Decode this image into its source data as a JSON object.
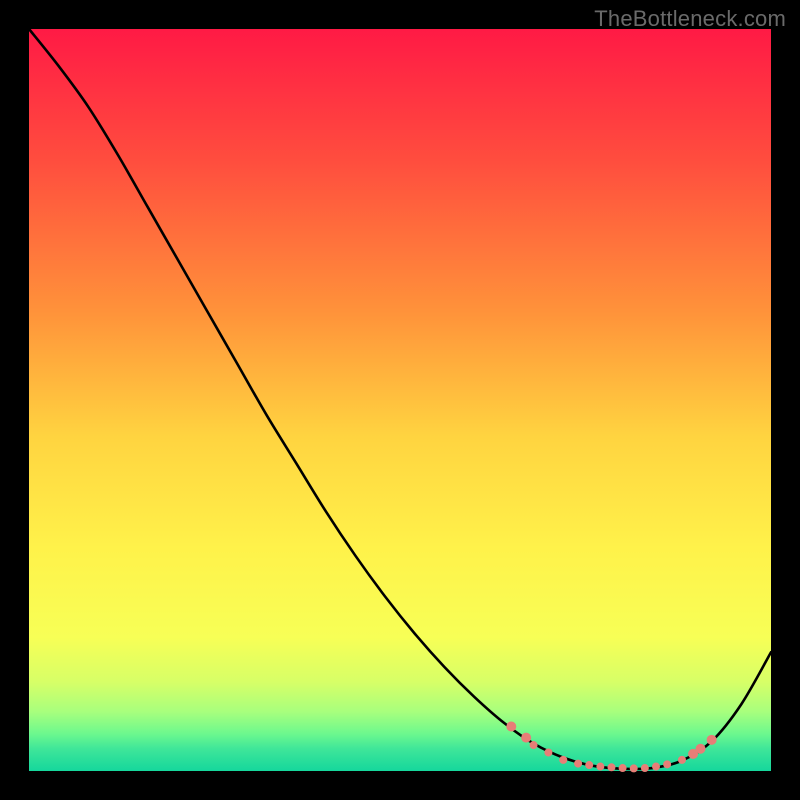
{
  "watermark": {
    "text": "TheBottleneck.com"
  },
  "chart_data": {
    "type": "line",
    "title": "",
    "xlabel": "",
    "ylabel": "",
    "xlim": [
      0,
      100
    ],
    "ylim": [
      0,
      100
    ],
    "gradient_stops": [
      {
        "offset": 0,
        "color": "#ff1a45"
      },
      {
        "offset": 18,
        "color": "#ff4e3e"
      },
      {
        "offset": 38,
        "color": "#ff923a"
      },
      {
        "offset": 55,
        "color": "#ffd440"
      },
      {
        "offset": 70,
        "color": "#fff24a"
      },
      {
        "offset": 82,
        "color": "#f7ff56"
      },
      {
        "offset": 88,
        "color": "#d7ff67"
      },
      {
        "offset": 92,
        "color": "#a8ff7d"
      },
      {
        "offset": 95,
        "color": "#6cf88e"
      },
      {
        "offset": 97,
        "color": "#3fe699"
      },
      {
        "offset": 100,
        "color": "#15d79c"
      }
    ],
    "series": [
      {
        "name": "curve",
        "x": [
          0,
          4,
          8,
          12,
          16,
          20,
          24,
          28,
          32,
          36,
          40,
          44,
          48,
          52,
          56,
          60,
          64,
          68,
          72,
          76,
          80,
          84,
          88,
          92,
          96,
          100
        ],
        "y": [
          100,
          95,
          89.5,
          83,
          76,
          69,
          62,
          55,
          48,
          41.5,
          35,
          29,
          23.5,
          18.5,
          14,
          10,
          6.5,
          3.7,
          1.8,
          0.7,
          0.3,
          0.4,
          1.4,
          4,
          9,
          16
        ]
      }
    ],
    "markers": {
      "name": "highlight-dots",
      "color": "#e77e77",
      "points": [
        {
          "x": 65,
          "y": 6.0,
          "r": 5
        },
        {
          "x": 67,
          "y": 4.5,
          "r": 5
        },
        {
          "x": 68,
          "y": 3.5,
          "r": 4
        },
        {
          "x": 70,
          "y": 2.5,
          "r": 4
        },
        {
          "x": 72,
          "y": 1.5,
          "r": 4
        },
        {
          "x": 74,
          "y": 1.0,
          "r": 4
        },
        {
          "x": 75.5,
          "y": 0.8,
          "r": 4
        },
        {
          "x": 77,
          "y": 0.6,
          "r": 4
        },
        {
          "x": 78.5,
          "y": 0.5,
          "r": 4
        },
        {
          "x": 80,
          "y": 0.4,
          "r": 4
        },
        {
          "x": 81.5,
          "y": 0.35,
          "r": 4
        },
        {
          "x": 83,
          "y": 0.4,
          "r": 4
        },
        {
          "x": 84.5,
          "y": 0.6,
          "r": 4
        },
        {
          "x": 86,
          "y": 0.9,
          "r": 4
        },
        {
          "x": 88,
          "y": 1.5,
          "r": 4
        },
        {
          "x": 89.5,
          "y": 2.3,
          "r": 5
        },
        {
          "x": 90.5,
          "y": 3.0,
          "r": 5
        },
        {
          "x": 92,
          "y": 4.2,
          "r": 5
        }
      ]
    }
  }
}
